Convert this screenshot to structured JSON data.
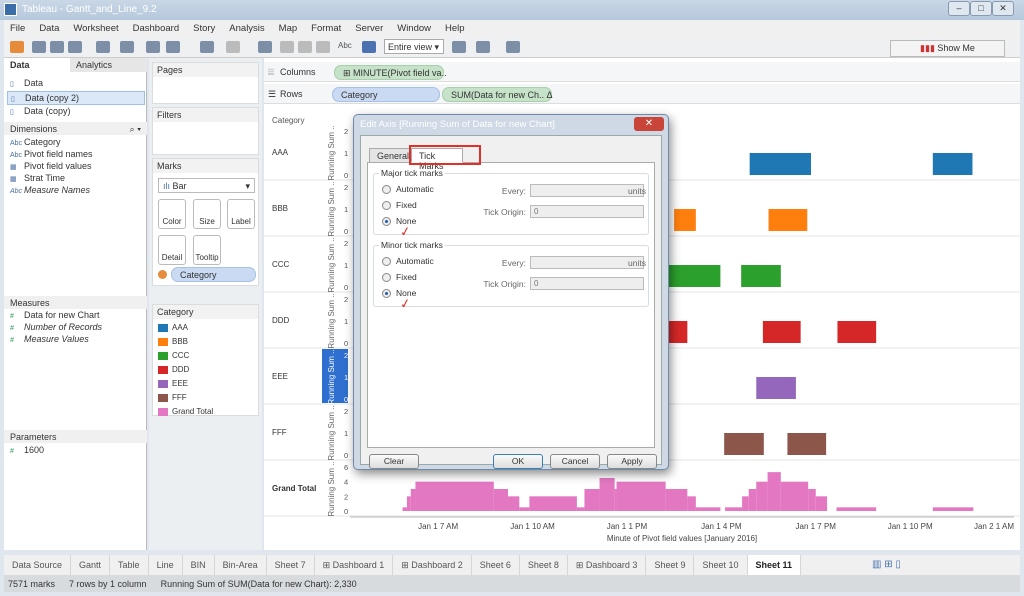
{
  "window": {
    "title": "Tableau - Gantt_and_Line_9.2"
  },
  "menu": [
    "File",
    "Data",
    "Worksheet",
    "Dashboard",
    "Story",
    "Analysis",
    "Map",
    "Format",
    "Server",
    "Window",
    "Help"
  ],
  "toolbar": {
    "fit_select": "Entire view",
    "show_me": "Show Me"
  },
  "data_pane": {
    "tabs": [
      "Data",
      "Analytics"
    ],
    "sources": [
      "Data",
      "Data (copy 2)",
      "Data (copy)"
    ],
    "selected_source": "Data (copy 2)",
    "dimensions_header": "Dimensions",
    "dimensions": [
      {
        "icon": "Abc",
        "label": "Category"
      },
      {
        "icon": "Abc",
        "label": "Pivot field names"
      },
      {
        "icon": "date-icon",
        "label": "Pivot field values"
      },
      {
        "icon": "date-icon",
        "label": "Strat Time"
      },
      {
        "icon": "Abc",
        "label": "Measure Names"
      }
    ],
    "measures_header": "Measures",
    "measures": [
      "Data for new Chart",
      "Number of Records",
      "Measure Values"
    ],
    "parameters_header": "Parameters",
    "parameters": [
      "1600"
    ]
  },
  "shelves": {
    "pages": "Pages",
    "filters": "Filters",
    "marks": "Marks",
    "mark_type": "Bar",
    "mark_buttons": [
      "Color",
      "Size",
      "Label",
      "Detail",
      "Tooltip"
    ],
    "color_pill": "Category",
    "legend_title": "Category",
    "legend": [
      {
        "label": "AAA",
        "color": "#1f77b4"
      },
      {
        "label": "BBB",
        "color": "#ff7f0e"
      },
      {
        "label": "CCC",
        "color": "#2ca02c"
      },
      {
        "label": "DDD",
        "color": "#d62728"
      },
      {
        "label": "EEE",
        "color": "#9467bd"
      },
      {
        "label": "FFF",
        "color": "#8c564b"
      },
      {
        "label": "Grand Total",
        "color": "#e377c2"
      }
    ]
  },
  "view": {
    "columns_label": "Columns",
    "columns_pill": "MINUTE(Pivot field va..",
    "rows_label": "Rows",
    "rows_pills": [
      "Category",
      "SUM(Data for new Ch..  Δ"
    ]
  },
  "chart_data": {
    "type": "bar",
    "row_header": "Category",
    "rows": [
      "AAA",
      "BBB",
      "CCC",
      "DDD",
      "EEE",
      "FFF",
      "Grand Total"
    ],
    "row_axis_title": "Running Sum ..",
    "row_axis_ticks": [
      0,
      1,
      2
    ],
    "grand_total_ticks": [
      0,
      2,
      4,
      6
    ],
    "xlabel": "Minute of Pivot field values [January 2016]",
    "x_ticks": [
      "Jan 1 7 AM",
      "Jan 1 10 AM",
      "Jan 1 1 PM",
      "Jan 1 4 PM",
      "Jan 1 7 PM",
      "Jan 1 10 PM",
      "Jan 2 1 AM"
    ],
    "x_unit": "hours since Jan 1 00:00",
    "x_tick_hours": [
      7,
      10,
      13,
      16,
      19,
      22,
      25
    ],
    "xlim_hours": [
      4.2,
      25.3
    ],
    "gantt": {
      "AAA": [
        [
          16.9,
          18.85
        ],
        [
          22.72,
          23.98
        ]
      ],
      "BBB": [
        [
          14.5,
          15.19
        ],
        [
          17.5,
          18.73
        ]
      ],
      "CCC": [
        [
          14.0,
          15.97
        ],
        [
          16.63,
          17.89
        ]
      ],
      "DDD": [
        [
          14.0,
          14.92
        ],
        [
          17.32,
          18.52
        ],
        [
          19.69,
          20.92
        ]
      ],
      "EEE": [
        [
          17.11,
          18.37
        ]
      ],
      "FFF": [
        [
          16.09,
          17.35
        ],
        [
          18.1,
          19.33
        ]
      ]
    },
    "grand_total_steps": [
      [
        5.87,
        0.5
      ],
      [
        6.01,
        2
      ],
      [
        6.13,
        3
      ],
      [
        6.28,
        4
      ],
      [
        8.77,
        3
      ],
      [
        9.22,
        2
      ],
      [
        9.58,
        0.5
      ],
      [
        9.9,
        2
      ],
      [
        11.41,
        0.5
      ],
      [
        11.65,
        3
      ],
      [
        12.13,
        4.5
      ],
      [
        12.61,
        3
      ],
      [
        12.67,
        4
      ],
      [
        14.23,
        3
      ],
      [
        14.92,
        2
      ],
      [
        15.19,
        0.5
      ],
      [
        15.97,
        0
      ],
      [
        16.12,
        0.5
      ],
      [
        16.66,
        2
      ],
      [
        16.87,
        3
      ],
      [
        17.11,
        4
      ],
      [
        17.47,
        5.3
      ],
      [
        17.89,
        4
      ],
      [
        18.76,
        3
      ],
      [
        19.0,
        2
      ],
      [
        19.36,
        0
      ],
      [
        19.66,
        0.5
      ],
      [
        20.92,
        0
      ],
      [
        22.72,
        0.5
      ],
      [
        24.01,
        0
      ]
    ],
    "highlighted_axis": "EEE"
  },
  "dialog": {
    "title": "Edit Axis [Running Sum of Data for new Chart]",
    "tabs": [
      "General",
      "Tick Marks"
    ],
    "active_tab": "Tick Marks",
    "major": {
      "title": "Major tick marks",
      "options": [
        "Automatic",
        "Fixed",
        "None"
      ],
      "selected": "None",
      "every_label": "Every:",
      "every_value": "",
      "units": "units",
      "origin_label": "Tick Origin:",
      "origin_value": "0"
    },
    "minor": {
      "title": "Minor tick marks",
      "options": [
        "Automatic",
        "Fixed",
        "None"
      ],
      "selected": "None",
      "every_label": "Every:",
      "every_value": "",
      "units": "units",
      "origin_label": "Tick Origin:",
      "origin_value": "0"
    },
    "buttons": {
      "clear": "Clear",
      "ok": "OK",
      "cancel": "Cancel",
      "apply": "Apply"
    },
    "annotation_color": "#e0302a"
  },
  "sheet_tabs": [
    "Data Source",
    "Gantt",
    "Table",
    "Line",
    "BIN",
    "Bin-Area",
    "Sheet 7",
    "⊞ Dashboard 1",
    "⊞ Dashboard 2",
    "Sheet 6",
    "Sheet 8",
    "⊞ Dashboard 3",
    "Sheet 9",
    "Sheet 10",
    "Sheet 11"
  ],
  "active_sheet": "Sheet 11",
  "status": {
    "marks": "7571 marks",
    "dims": "7 rows by 1 column",
    "summary": "Running Sum of SUM(Data for new Chart): 2,330"
  }
}
